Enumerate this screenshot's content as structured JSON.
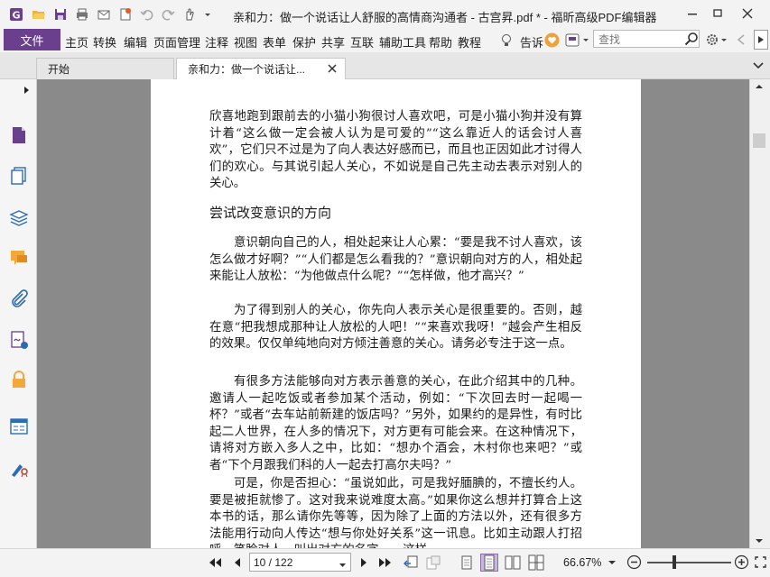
{
  "window": {
    "title": "亲和力：做一个说话让人舒服的高情商沟通者 - 古宫昇.pdf * - 福昕高级PDF编辑器"
  },
  "menu": {
    "file": "文件",
    "items": [
      "主页",
      "转换",
      "编辑",
      "页面管理",
      "注释",
      "视图",
      "表单",
      "保护",
      "共享",
      "互联",
      "辅助工具",
      "帮助",
      "教程"
    ],
    "tell": "告诉",
    "search_placeholder": "查找"
  },
  "tabs": [
    {
      "label": "开始"
    },
    {
      "label": "亲和力：做一个说话让..."
    }
  ],
  "document": {
    "paragraphs": [
      "欣喜地跑到跟前去的小猫小狗很讨人喜欢吧，可是小猫小狗并没有算计着“这么做一定会被人认为是可爱的”“这么靠近人的话会讨人喜欢”，它们只不过是为了向人表达好感而已，而且也正因如此才讨得人们的欢心。与其说引起人关心，不如说是自己先主动去表示对别人的关心。",
      "尝试改变意识的方向",
      "意识朝向自己的人，相处起来让人心累：“要是我不讨人喜欢，该怎么做才好啊？”“人们都是怎么看我的？”意识朝向对方的人，相处起来能让人放松：“为他做点什么呢？”“怎样做，他才高兴？”",
      "为了得到别人的关心，你先向人表示关心是很重要的。否则，越在意“把我想成那种让人放松的人吧！”“来喜欢我呀！”越会产生相反的效果。仅仅单纯地向对方倾注善意的关心。请务必专注于这一点。",
      "有很多方法能够向对方表示善意的关心，在此介绍其中的几种。邀请人一起吃饭或者参加某个活动，例如：“下次回去时一起喝一杯？”或者“去车站前新建的饭店吗？”另外，如果约的是异性，有时比起二人世界，在人多的情况下，对方更有可能会来。在这种情况下，请将对方嵌入多人之中，比如：“想办个酒会，木村你也来吧？”或者“下个月跟我们科的人一起去打高尔夫吗？”",
      "可是，你是否担心：“虽说如此，可是我好腼腆的，不擅长约人。要是被拒就惨了。这对我来说难度太高。”如果你这么想并打算合上这本书的话，那么请你先等等，因为除了上面的方法以外，还有很多方法能用行动向人传达“想与你处好关系”这一讯息。比如主动跟人打招呼、笑脸对人、叫出对方的名字……这样"
    ]
  },
  "status": {
    "page_display": "10 / 122",
    "zoom": "66.67%"
  },
  "colors": {
    "accent": "#6a3f8e",
    "doc_background": "#8a8a8a"
  },
  "icons": [
    "app-logo-icon",
    "open-icon",
    "save-icon",
    "print-icon",
    "email-icon",
    "new-icon",
    "undo-icon",
    "redo-icon",
    "hand-icon",
    "bulb-icon",
    "heart-icon",
    "skin-icon",
    "search-icon",
    "gear-icon",
    "minimize-icon",
    "restore-icon",
    "close-icon"
  ]
}
